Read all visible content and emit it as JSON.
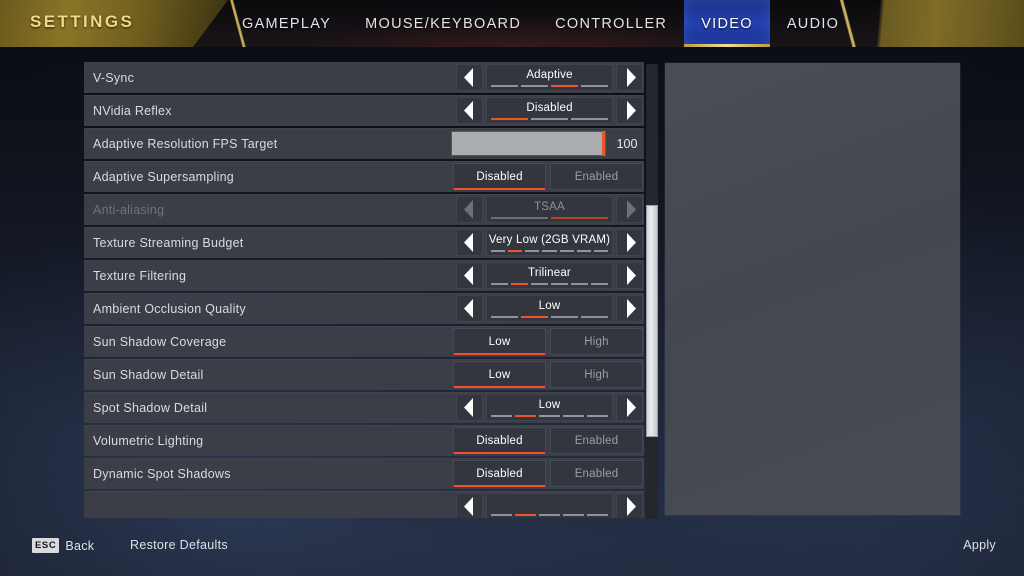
{
  "header": {
    "title": "SETTINGS",
    "tabs": [
      {
        "label": "GAMEPLAY",
        "active": false
      },
      {
        "label": "MOUSE/KEYBOARD",
        "active": false
      },
      {
        "label": "CONTROLLER",
        "active": false
      },
      {
        "label": "VIDEO",
        "active": true
      },
      {
        "label": "AUDIO",
        "active": false
      }
    ]
  },
  "colors": {
    "accent_orange": "#f0522a",
    "gold": "#c7ae5c",
    "tab_active_blue": "#2440ad",
    "row_bg": "#3b3e47"
  },
  "settings": [
    {
      "label": "V-Sync",
      "type": "stepper",
      "value": "Adaptive",
      "segments": 4,
      "active_segment": 3,
      "disabled": false
    },
    {
      "label": "NVidia Reflex",
      "type": "stepper",
      "value": "Disabled",
      "segments": 3,
      "active_segment": 1,
      "disabled": false
    },
    {
      "label": "Adaptive Resolution FPS Target",
      "type": "slider",
      "value": "100",
      "fill_percent": 100,
      "disabled": false
    },
    {
      "label": "Adaptive Supersampling",
      "type": "toggle",
      "options": [
        "Disabled",
        "Enabled"
      ],
      "selected_index": 0,
      "disabled": false
    },
    {
      "label": "Anti-aliasing",
      "type": "stepper",
      "value": "TSAA",
      "segments": 2,
      "active_segment": 2,
      "disabled": true
    },
    {
      "label": "Texture Streaming Budget",
      "type": "stepper",
      "value": "Very Low (2GB VRAM)",
      "segments": 7,
      "active_segment": 2,
      "disabled": false
    },
    {
      "label": "Texture Filtering",
      "type": "stepper",
      "value": "Trilinear",
      "segments": 6,
      "active_segment": 2,
      "disabled": false
    },
    {
      "label": "Ambient Occlusion Quality",
      "type": "stepper",
      "value": "Low",
      "segments": 4,
      "active_segment": 2,
      "disabled": false
    },
    {
      "label": "Sun Shadow Coverage",
      "type": "toggle",
      "options": [
        "Low",
        "High"
      ],
      "selected_index": 0,
      "disabled": false
    },
    {
      "label": "Sun Shadow Detail",
      "type": "toggle",
      "options": [
        "Low",
        "High"
      ],
      "selected_index": 0,
      "disabled": false
    },
    {
      "label": "Spot Shadow Detail",
      "type": "stepper",
      "value": "Low",
      "segments": 5,
      "active_segment": 2,
      "disabled": false
    },
    {
      "label": "Volumetric Lighting",
      "type": "toggle",
      "options": [
        "Disabled",
        "Enabled"
      ],
      "selected_index": 0,
      "disabled": false
    },
    {
      "label": "Dynamic Spot Shadows",
      "type": "toggle",
      "options": [
        "Disabled",
        "Enabled"
      ],
      "selected_index": 0,
      "disabled": false
    },
    {
      "label": "",
      "type": "stepper",
      "value": "",
      "segments": 5,
      "active_segment": 2,
      "disabled": false
    }
  ],
  "scrollbar": {
    "thumb_top_percent": 31,
    "thumb_height_percent": 51
  },
  "footer": {
    "back_key": "ESC",
    "back_label": "Back",
    "restore_label": "Restore Defaults",
    "apply_label": "Apply"
  }
}
